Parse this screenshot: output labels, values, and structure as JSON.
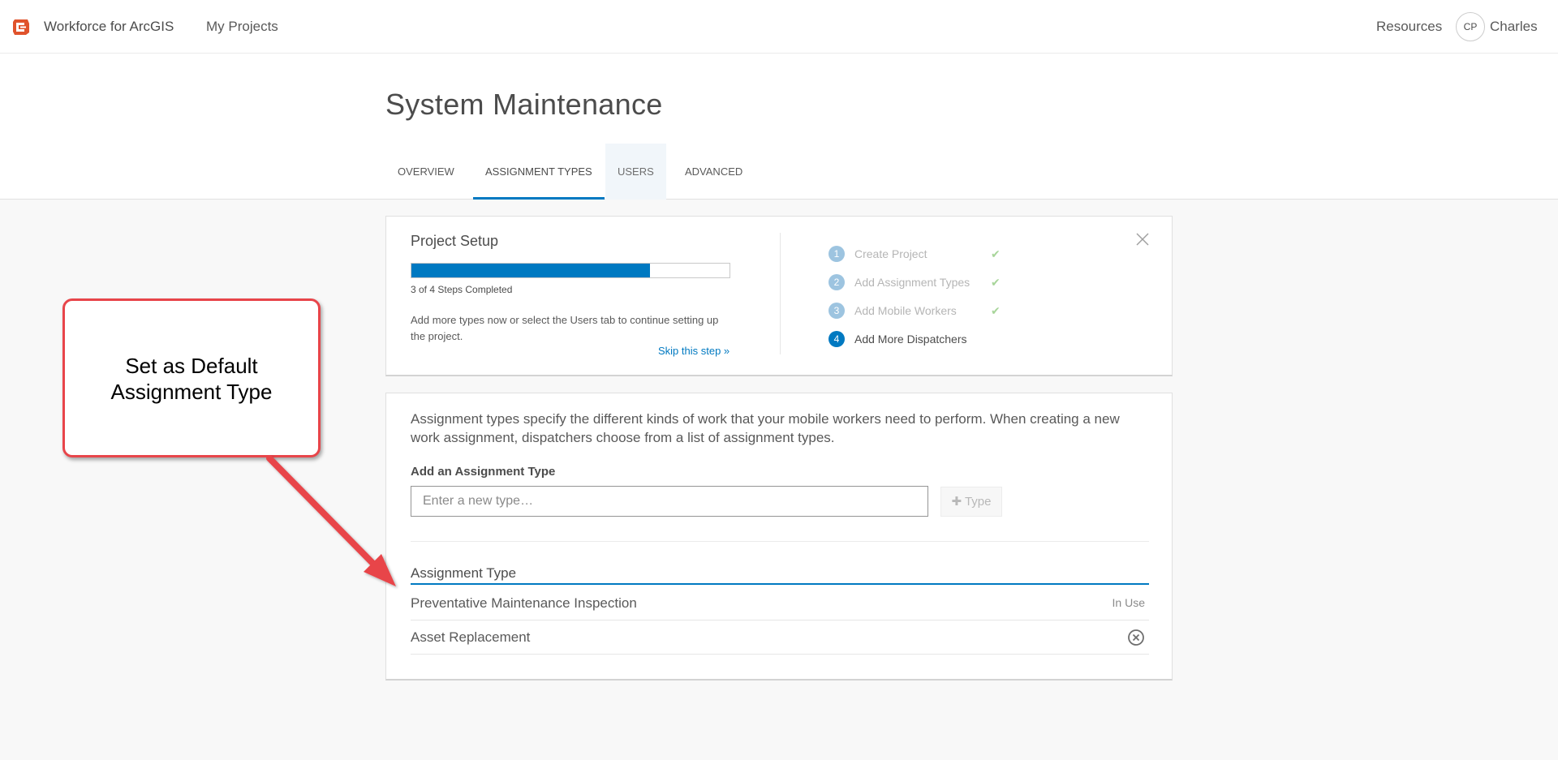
{
  "topnav": {
    "app_title": "Workforce for ArcGIS",
    "my_projects": "My Projects",
    "resources": "Resources",
    "avatar_initials": "CP",
    "username": "Charles",
    "logo_icon": "workforce-logo-icon",
    "logo_color": "#e0532c"
  },
  "header": {
    "title": "System Maintenance",
    "tabs": [
      {
        "label": "OVERVIEW"
      },
      {
        "label": "ASSIGNMENT TYPES"
      },
      {
        "label": "USERS"
      },
      {
        "label": "ADVANCED"
      }
    ]
  },
  "setup": {
    "title": "Project Setup",
    "progress_percent": 75,
    "steps_completed": "3 of 4 Steps Completed",
    "description": "Add more types now or select the Users tab to continue setting up the project.",
    "skip_link": "Skip this step »",
    "steps": [
      {
        "num": "1",
        "label": "Create Project",
        "done": true
      },
      {
        "num": "2",
        "label": "Add Assignment Types",
        "done": true
      },
      {
        "num": "3",
        "label": "Add Mobile Workers",
        "done": true
      },
      {
        "num": "4",
        "label": "Add More Dispatchers",
        "done": false
      }
    ]
  },
  "types": {
    "description": "Assignment types specify the different kinds of work that your mobile workers need to perform. When creating a new work assignment, dispatchers choose from a list of assignment types.",
    "add_label": "Add an Assignment Type",
    "input_placeholder": "Enter a new type…",
    "add_button": "Type",
    "column_header": "Assignment Type",
    "rows": [
      {
        "name": "Preventative Maintenance Inspection",
        "status": "In Use"
      },
      {
        "name": "Asset Replacement",
        "status": ""
      }
    ]
  },
  "callout": {
    "line1": "Set as Default",
    "line2": "Assignment Type",
    "border_color": "#e8454a"
  },
  "colors": {
    "accent": "#0079c1",
    "check": "#a8d59a"
  }
}
